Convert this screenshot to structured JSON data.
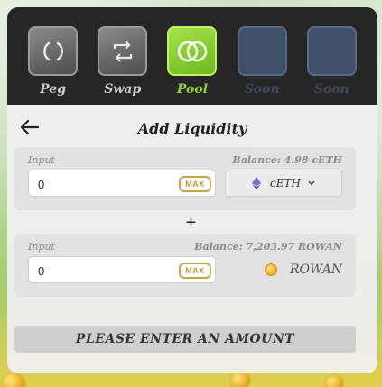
{
  "nav": {
    "items": [
      {
        "label": "Peg",
        "state": "normal"
      },
      {
        "label": "Swap",
        "state": "normal"
      },
      {
        "label": "Pool",
        "state": "active"
      },
      {
        "label": "Soon",
        "state": "disabled"
      },
      {
        "label": "Soon",
        "state": "disabled"
      }
    ]
  },
  "header": {
    "title": "Add Liquidity"
  },
  "from": {
    "input_label": "Input",
    "balance": "Balance: 4.98 cETH",
    "amount": "0",
    "max_label": "MAX",
    "token": "cETH"
  },
  "plus_symbol": "+",
  "to": {
    "input_label": "Input",
    "balance": "Balance: 7,203.97 ROWAN",
    "amount": "0",
    "max_label": "MAX",
    "token": "ROWAN"
  },
  "cta": {
    "label": "PLEASE ENTER AN AMOUNT"
  },
  "colors": {
    "nav_bg": "#262626",
    "active_green": "#8fd33a",
    "max_gold": "#c39a3c"
  },
  "icons": [
    "refresh-icon",
    "swap-icon",
    "pool-icon",
    "back-arrow-icon",
    "eth-icon",
    "chevron-down-icon",
    "rowan-coin-icon"
  ]
}
